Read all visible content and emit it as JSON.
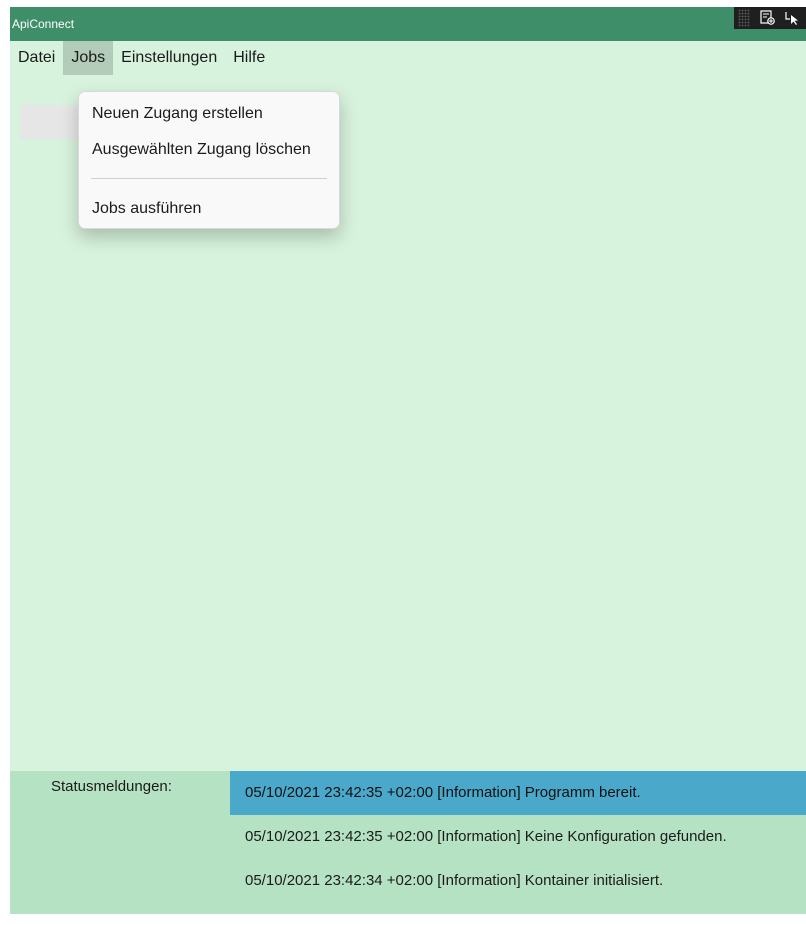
{
  "window": {
    "title": "ApiConnect"
  },
  "menubar": {
    "items": [
      {
        "label": "Datei"
      },
      {
        "label": "Jobs",
        "active": true
      },
      {
        "label": "Einstellungen"
      },
      {
        "label": "Hilfe"
      }
    ]
  },
  "jobs_menu": {
    "items": [
      {
        "label": "Neuen Zugang erstellen"
      },
      {
        "label": "Ausgewählten Zugang löschen"
      },
      {
        "label": "Jobs ausführen"
      }
    ]
  },
  "status": {
    "label": "Statusmeldungen:",
    "messages": [
      {
        "text": "05/10/2021 23:42:35 +02:00 [Information] Programm bereit.",
        "selected": true
      },
      {
        "text": "05/10/2021 23:42:35 +02:00 [Information] Keine Konfiguration gefunden.",
        "selected": false
      },
      {
        "text": "05/10/2021 23:42:34 +02:00 [Information] Kontainer initialisiert.",
        "selected": false
      }
    ]
  },
  "icons": {
    "toolbar": [
      "live-visual-tree-icon",
      "select-element-icon"
    ]
  },
  "colors": {
    "titlebar": "#3f8e6a",
    "content_background": "#d7f2dd",
    "status_background": "#b5e2c3",
    "selected_row": "#4aa8cb",
    "active_menu": "#b3ccba"
  }
}
